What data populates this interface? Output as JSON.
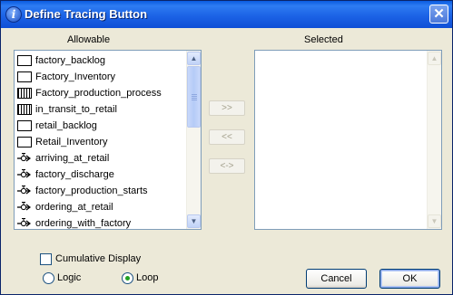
{
  "window": {
    "title": "Define Tracing Button",
    "title_icon_glyph": "i",
    "close_glyph": "✕"
  },
  "allowable": {
    "label": "Allowable",
    "items": [
      {
        "label": "factory_backlog",
        "icon": "stock-icon"
      },
      {
        "label": "Factory_Inventory",
        "icon": "stock-icon"
      },
      {
        "label": "Factory_production_process",
        "icon": "conveyor-icon"
      },
      {
        "label": "in_transit_to_retail",
        "icon": "conveyor-icon"
      },
      {
        "label": "retail_backlog",
        "icon": "stock-icon"
      },
      {
        "label": "Retail_Inventory",
        "icon": "stock-icon"
      },
      {
        "label": "arriving_at_retail",
        "icon": "flow-icon"
      },
      {
        "label": "factory_discharge",
        "icon": "flow-icon"
      },
      {
        "label": "factory_production_starts",
        "icon": "flow-icon"
      },
      {
        "label": "ordering_at_retail",
        "icon": "flow-icon"
      },
      {
        "label": "ordering_with_factory",
        "icon": "flow-icon"
      }
    ]
  },
  "selected": {
    "label": "Selected",
    "items": []
  },
  "move_buttons": {
    "add": ">>",
    "remove": "<<",
    "swap": "<->"
  },
  "options": {
    "cumulative_display": {
      "label": "Cumulative Display",
      "checked": false
    },
    "mode": {
      "options": [
        "Logic",
        "Loop"
      ],
      "selected": "Loop"
    }
  },
  "buttons": {
    "cancel": "Cancel",
    "ok": "OK"
  },
  "colors": {
    "titlebar": "#0a5be0",
    "dialog_bg": "#ece9d8",
    "radio_selected": "#21a121"
  },
  "scroll_glyphs": {
    "up": "▲",
    "down": "▼"
  }
}
